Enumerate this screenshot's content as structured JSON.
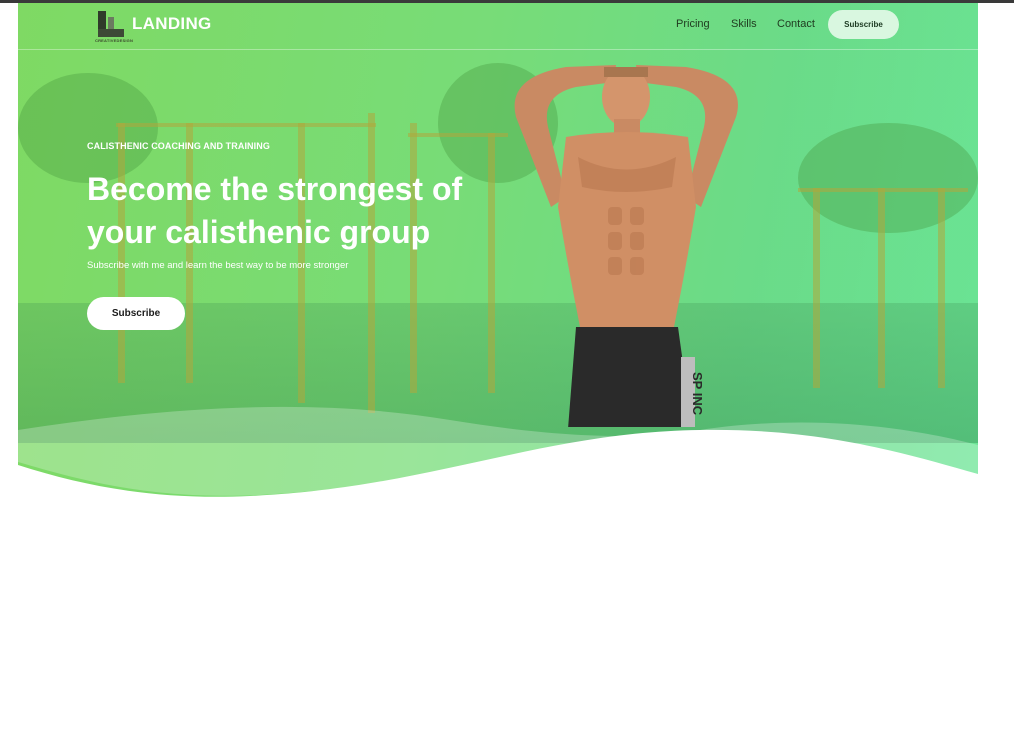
{
  "brand": {
    "name": "LANDING",
    "sub": "CREATIVEDESIGN",
    "icon": "logo-mark-icon"
  },
  "nav": {
    "links": [
      "Pricing",
      "Skills",
      "Contact"
    ],
    "subscribe_label": "Subscribe"
  },
  "hero": {
    "tagline": "CALISTHENIC COACHING AND TRAINING",
    "headline": "Become the strongest of your calisthenic group",
    "subtext": "Subscribe with me and learn the best way to be more stronger",
    "cta_label": "Subscribe",
    "image": "athlete-photo"
  },
  "colors": {
    "hero_gradient_start": "#74d656",
    "hero_gradient_end": "#5ee28c",
    "text": "#ffffff",
    "nav_button_bg": "#d9f7e0"
  }
}
